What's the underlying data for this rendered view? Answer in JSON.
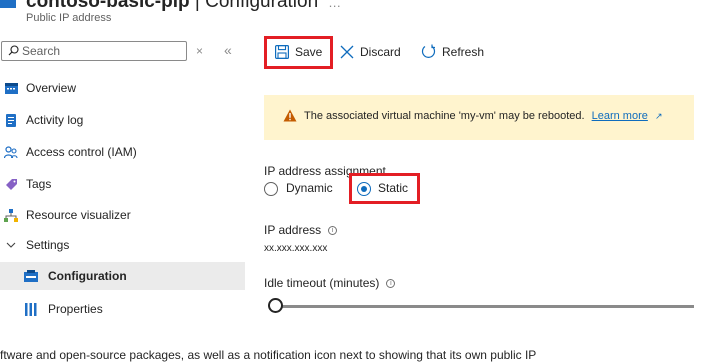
{
  "header": {
    "resource_name": "contoso-basic-pip",
    "separator": " | ",
    "blade_title": "Configuration",
    "more": "…",
    "subtitle": "Public IP address"
  },
  "sidebar": {
    "search_placeholder": "Search",
    "clear_glyph": "×",
    "collapse_glyph": "«",
    "items": [
      {
        "label": "Overview",
        "icon": "overview-icon"
      },
      {
        "label": "Activity log",
        "icon": "activity-log-icon"
      },
      {
        "label": "Access control (IAM)",
        "icon": "access-control-icon"
      },
      {
        "label": "Tags",
        "icon": "tags-icon"
      },
      {
        "label": "Resource visualizer",
        "icon": "resource-visualizer-icon"
      },
      {
        "label": "Settings",
        "icon": "chevron-down-icon"
      },
      {
        "label": "Configuration",
        "icon": "configuration-icon",
        "selected": true
      },
      {
        "label": "Properties",
        "icon": "properties-icon"
      }
    ]
  },
  "toolbar": {
    "save_label": "Save",
    "discard_label": "Discard",
    "refresh_label": "Refresh"
  },
  "banner": {
    "text": "The associated virtual machine 'my-vm' may be rebooted.",
    "link": "Learn more"
  },
  "form": {
    "assignment_label": "IP address assignment",
    "options": [
      "Dynamic",
      "Static"
    ],
    "selected_option": "Static",
    "ip_label": "IP address",
    "ip_value": "xx.xxx.xxx.xxx",
    "idle_label": "Idle timeout (minutes)",
    "idle_value_fraction": 0
  },
  "footer": {
    "text": "ftware and open-source packages, as well as a notification icon next to showing that its own public IP"
  },
  "colors": {
    "highlight": "#e31e24",
    "accent": "#0f6cbd",
    "warning_bg": "#fff4ce",
    "selected_bg": "#ebebeb"
  }
}
